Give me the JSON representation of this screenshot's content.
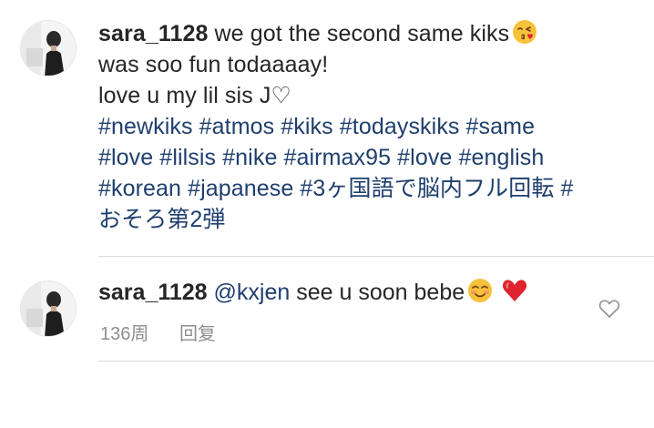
{
  "caption": {
    "username": "sara_1128",
    "line1_text": "we got the second same kiks",
    "line1_emoji": "face-blowing-kiss-icon",
    "line2": "was soo fun todaaaay!",
    "line3": "love u my lil sis J♡",
    "hashtag_lines": [
      "#newkiks #atmos #kiks #todayskiks #same",
      "#love #lilsis #nike #airmax95 #love #english",
      "#korean #japanese #3ヶ国語で脳内フル回転 #",
      "おそろ第2弾"
    ]
  },
  "comment": {
    "username": "sara_1128",
    "mention": "@kxjen",
    "text": "see u soon bebe",
    "emojis": [
      "smiling-face-icon",
      "red-heart-icon"
    ],
    "time": "136周",
    "reply_label": "回复",
    "like_icon": "heart-outline-icon"
  },
  "colors": {
    "text": "#262626",
    "hashtag": "#1f3f6e",
    "meta": "#8e8e8e",
    "divider": "#dbdbdb",
    "heart": "#e0242f"
  }
}
